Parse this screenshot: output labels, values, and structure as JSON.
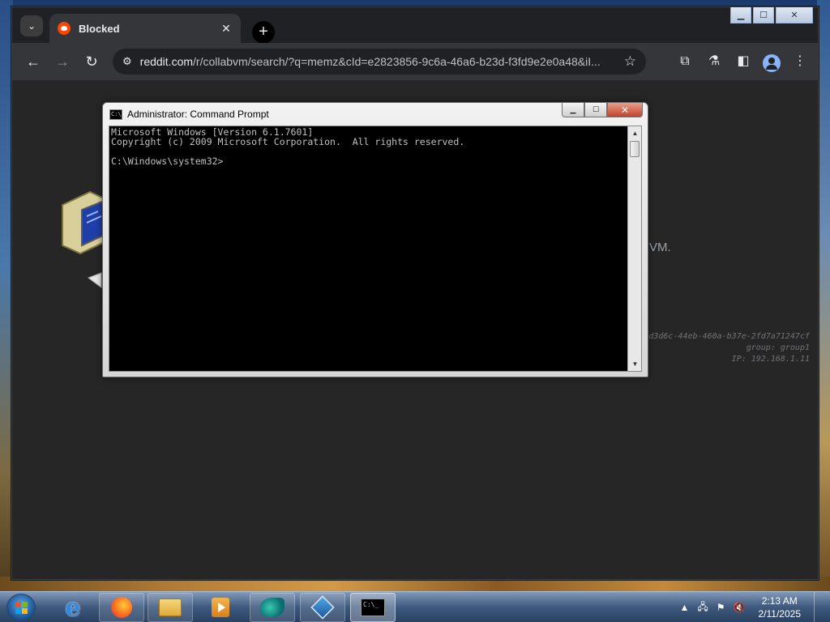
{
  "browser": {
    "tab": {
      "title": "Blocked",
      "favicon": "reddit-icon"
    },
    "tab_search_icon": "chevron-down-icon",
    "new_tab_label": "+",
    "url_host": "reddit.com",
    "url_path": "/r/collabvm/search/?q=memz&cId=e2823856-9c6a-46a6-b23d-f3fd9e2e0a48&iI..."
  },
  "page": {
    "partial_text": "VM.",
    "meta_line1": "d3d6c-44eb-460a-b37e-2fd7a71247cf",
    "meta_line2": "group: group1",
    "meta_line3": "IP: 192.168.1.11"
  },
  "cmd": {
    "title": "Administrator: Command Prompt",
    "console": "Microsoft Windows [Version 6.1.7601]\nCopyright (c) 2009 Microsoft Corporation.  All rights reserved.\n\nC:\\Windows\\system32>"
  },
  "taskbar": {
    "apps": [
      "start",
      "internet-explorer",
      "firefox",
      "file-explorer",
      "media-player",
      "app",
      "virtualbox",
      "command-prompt"
    ],
    "clock_time": "2:13 AM",
    "clock_date": "2/11/2025"
  },
  "colors": {
    "chrome_bg": "#202124",
    "page_bg": "#262626",
    "reddit_orange": "#ff4500",
    "avatar_blue": "#8ab4f8"
  }
}
